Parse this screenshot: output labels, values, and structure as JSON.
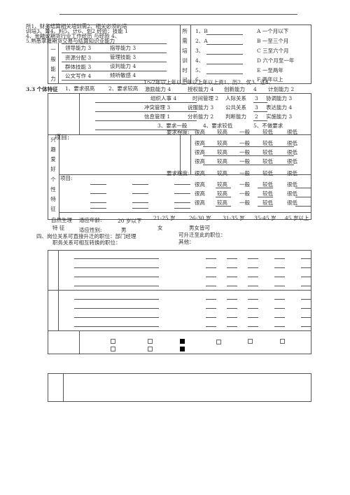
{
  "header_lines": [
    "所1、财务结算相关培训需2、相关必须的培",
    "训培3、算4、料5、计6、划2 经验：技能 1",
    "4、金融或期货行业工作经历     与经验   4、",
    "5.熟悉掌握期货交易与结算知识业能力"
  ],
  "general_ability": {
    "label": "一般能力",
    "items": [
      "领导能力 3",
      "指导能力 3",
      "资源分配 3",
      "管理技能 3",
      "群体技能 3",
      "谈判能力 4",
      "公文写作 4",
      "倾听敏感 4"
    ]
  },
  "training_time": {
    "label": "所需培训时间",
    "answers": [
      "1、B",
      "2、A",
      "3、",
      "4、",
      "5、",
      "6、"
    ],
    "options": [
      "A 一个月以下",
      "B 一至三个月",
      "C 三至六个月",
      "D 六个月至一年",
      "E 一至两年",
      "F 两年以上"
    ]
  },
  "overlap_line": "1～2年以上年以上年以上年以上资1、历2、优3、证4、",
  "section33": {
    "title": "3.3 个体特征",
    "scale_top": [
      "1、要求很高",
      "2、要求较高"
    ],
    "abilities": [
      "激励能力 4",
      "授权能力 4",
      "创新能力",
      "4",
      "计划能力 2",
      "组织人事 4",
      "时间管理 2",
      "人际关系",
      "3",
      "协调能力 3",
      "冲突管理   3",
      "说服能力   3",
      "公共关系",
      "3",
      "表达能力 4",
      "信息管理   1",
      "分析能力   2",
      "判断能力",
      "2",
      "实施能力 3"
    ],
    "scale_bottom": [
      "3、要求一般",
      "4、要求较低",
      "5、不做要求"
    ]
  },
  "interests": {
    "label": "兴趣爱好",
    "item_label": "项目:",
    "degree_label": "要求程度:",
    "levels": [
      "很高",
      "较高",
      "一般",
      "较低",
      "很低"
    ]
  },
  "personality": {
    "label": "个性特征",
    "item_label": "项目:",
    "degree_label": "要求程度:"
  },
  "natural": {
    "label1": "自然生理",
    "label2": "特    征",
    "age_label": "适应年龄:",
    "ages": [
      "20 岁以下",
      "21-25 岁",
      "26-30 岁",
      "31-35 岁",
      "35-45 岁",
      "45 岁以上"
    ],
    "gender_label": "适应性别:",
    "genders": [
      "男",
      "女",
      "男女皆可"
    ]
  },
  "section4": {
    "line1": "四、岗位关系可直接升迁的职位：部门经理",
    "line2": "职务关系可相互转换的职位：",
    "line3": "可升迁至此的职位：",
    "line4": "其他："
  },
  "checkboxes": [
    false,
    false,
    false,
    false,
    true,
    true,
    false,
    false,
    false
  ]
}
